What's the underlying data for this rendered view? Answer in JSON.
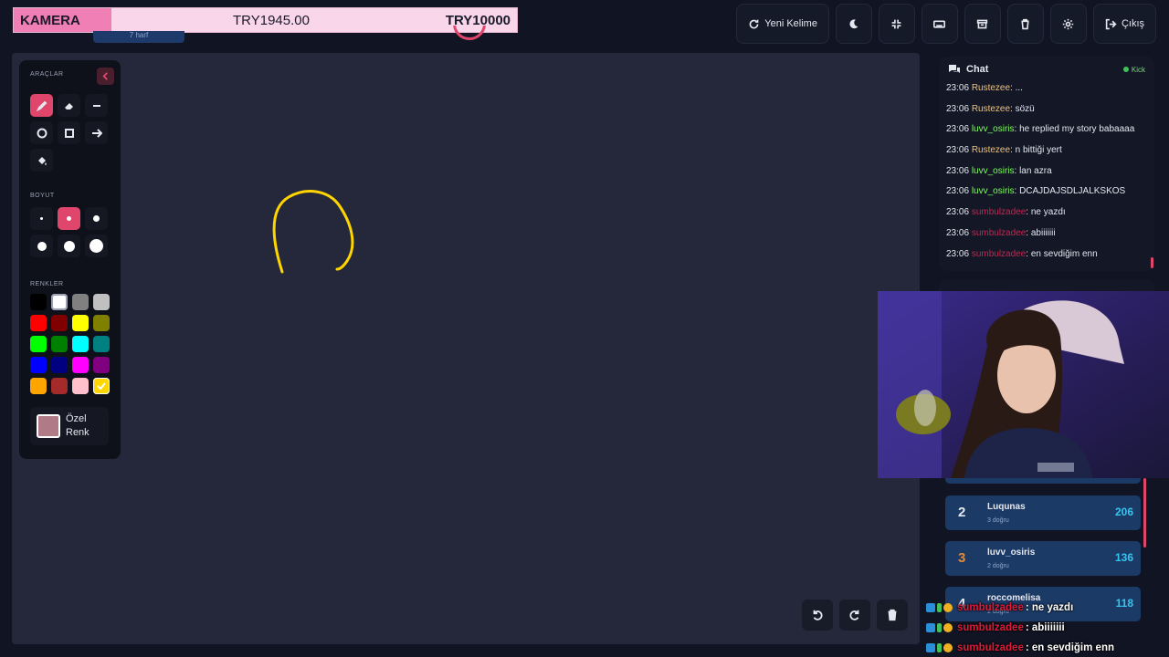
{
  "donation": {
    "label": "KAMERA",
    "current": "TRY1945.00",
    "goal": "TRY10000",
    "progress_fraction": 0.195
  },
  "word": {
    "hint": "7 harf"
  },
  "top_buttons": [
    {
      "name": "new-word-button",
      "icon": "refresh-icon",
      "label": "Yeni Kelime"
    },
    {
      "name": "dark-mode-button",
      "icon": "moon-icon",
      "label": ""
    },
    {
      "name": "compress-button",
      "icon": "compress-icon",
      "label": ""
    },
    {
      "name": "keyboard-button",
      "icon": "keyboard-icon",
      "label": ""
    },
    {
      "name": "archive-button",
      "icon": "archive-icon",
      "label": ""
    },
    {
      "name": "trash-button",
      "icon": "trash-icon",
      "label": ""
    },
    {
      "name": "settings-button",
      "icon": "gear-icon",
      "label": ""
    },
    {
      "name": "logout-button",
      "icon": "logout-icon",
      "label": "Çıkış"
    }
  ],
  "tools": {
    "tools_title": "ARAÇLAR",
    "size_title": "BOYUT",
    "colors_title": "RENKLER",
    "tool_items": [
      "brush",
      "eraser",
      "line",
      "circle",
      "square",
      "arrow",
      "fill"
    ],
    "active_tool": "brush",
    "active_size_index": 1,
    "colors": [
      "#000000",
      "#ffffff",
      "#808080",
      "#c0c0c0",
      "#ff0000",
      "#800000",
      "#ffff00",
      "#808000",
      "#00ff00",
      "#008000",
      "#00ffff",
      "#008080",
      "#0000ff",
      "#000080",
      "#ff00ff",
      "#800080",
      "#ffa500",
      "#a52a2a",
      "#ffc0cb",
      "#ffd700"
    ],
    "selected_color": "#ffd700",
    "custom_color_label": "Özel Renk",
    "custom_color": "#b07a86"
  },
  "chat": {
    "title": "Chat",
    "platform": "Kick",
    "messages": [
      {
        "time": "23:06",
        "user": "Rustezee",
        "user_color": "#f0c27a",
        "text": "..."
      },
      {
        "time": "23:06",
        "user": "Rustezee",
        "user_color": "#f0c27a",
        "text": "sözü"
      },
      {
        "time": "23:06",
        "user": "luvv_osiris",
        "user_color": "#7dff5a",
        "text": "he replied my story babaaaa"
      },
      {
        "time": "23:06",
        "user": "Rustezee",
        "user_color": "#f0c27a",
        "text": "n bittiği yert"
      },
      {
        "time": "23:06",
        "user": "luvv_osiris",
        "user_color": "#7dff5a",
        "text": "lan azra"
      },
      {
        "time": "23:06",
        "user": "luvv_osiris",
        "user_color": "#7dff5a",
        "text": "DCAJDAJSDLJALKSKOS"
      },
      {
        "time": "23:06",
        "user": "sumbulzadee",
        "user_color": "#c8244f",
        "text": "ne yazdı"
      },
      {
        "time": "23:06",
        "user": "sumbulzadee",
        "user_color": "#c8244f",
        "text": "abiiiiiii"
      },
      {
        "time": "23:06",
        "user": "sumbulzadee",
        "user_color": "#c8244f",
        "text": "en sevdiğim enn"
      }
    ]
  },
  "leaderboard": [
    {
      "rank": "2",
      "rank_color": "#e6e8f0",
      "name": "Luqunas",
      "sub": "3 doğru",
      "score": "206"
    },
    {
      "rank": "3",
      "rank_color": "#e08a3a",
      "name": "luvv_osiris",
      "sub": "2 doğru",
      "score": "136"
    },
    {
      "rank": "4",
      "rank_color": "#e6e8f0",
      "name": "roccomelisa",
      "sub": "2 doğru",
      "score": "118"
    }
  ],
  "overlay_chat": [
    {
      "user": "sumbulzadee",
      "text": ": ne yazdı"
    },
    {
      "user": "sumbulzadee",
      "text": ": abiiiiiii"
    },
    {
      "user": "sumbulzadee",
      "text": ": en sevdiğim enn"
    }
  ],
  "colors": {
    "accent": "#e0466b",
    "canvas": "#25273a",
    "panel": "#131726",
    "stroke": "#ffd500"
  }
}
